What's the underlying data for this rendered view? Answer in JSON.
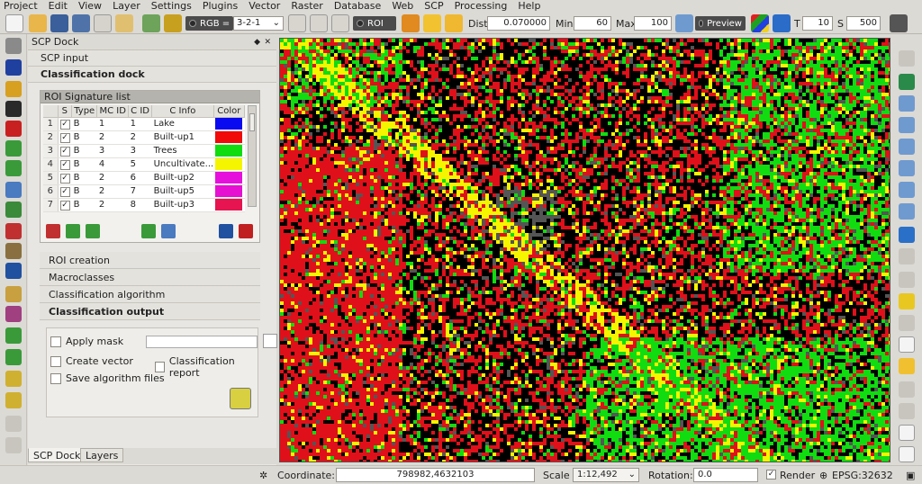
{
  "menu": [
    "Project",
    "Edit",
    "View",
    "Layer",
    "Settings",
    "Plugins",
    "Vector",
    "Raster",
    "Database",
    "Web",
    "SCP",
    "Processing",
    "Help"
  ],
  "toolbar": {
    "rgb_label": "RGB =",
    "rgb_value": "3-2-1",
    "roi_label": "ROI",
    "dist_label": "Dist",
    "dist_value": "0.070000",
    "min_label": "Min",
    "min_value": "60",
    "max_label": "Max",
    "max_value": "100",
    "preview_label": "Preview",
    "t_label": "T",
    "t_value": "10",
    "s_label": "S",
    "s_value": "500"
  },
  "dock": {
    "title": "SCP Dock",
    "tabs": [
      "SCP input",
      "Classification dock"
    ],
    "signature_list": {
      "title": "ROI Signature list",
      "columns": [
        "S",
        "Type",
        "MC ID",
        "C ID",
        "C Info",
        "Color"
      ],
      "rows": [
        {
          "n": "1",
          "type": "B",
          "mc": "1",
          "c": "1",
          "info": "Lake",
          "color": "#0a0af0"
        },
        {
          "n": "2",
          "type": "B",
          "mc": "2",
          "c": "2",
          "info": "Built-up1",
          "color": "#f00a0a"
        },
        {
          "n": "3",
          "type": "B",
          "mc": "3",
          "c": "3",
          "info": "Trees",
          "color": "#10dc10"
        },
        {
          "n": "4",
          "type": "B",
          "mc": "4",
          "c": "5",
          "info": "Uncultivate...",
          "color": "#f5f500"
        },
        {
          "n": "5",
          "type": "B",
          "mc": "2",
          "c": "6",
          "info": "Built-up2",
          "color": "#e610dc"
        },
        {
          "n": "6",
          "type": "B",
          "mc": "2",
          "c": "7",
          "info": "Built-up5",
          "color": "#e610d2"
        },
        {
          "n": "7",
          "type": "B",
          "mc": "2",
          "c": "8",
          "info": "Built-up3",
          "color": "#e61450"
        }
      ]
    },
    "sections": [
      "ROI creation",
      "Macroclasses",
      "Classification algorithm",
      "Classification output"
    ],
    "output": {
      "apply_mask": "Apply mask",
      "create_vector": "Create vector",
      "classification_report": "Classification report",
      "save_algorithm_files": "Save algorithm files"
    },
    "bottom_tabs": [
      "SCP Dock",
      "Layers"
    ]
  },
  "status": {
    "coordinate_label": "Coordinate:",
    "coordinate_value": "798982,4632103",
    "scale_label": "Scale",
    "scale_value": "1:12,492",
    "rotation_label": "Rotation:",
    "rotation_value": "0.0",
    "render_label": "Render",
    "crs": "EPSG:32632"
  },
  "colors": {
    "map_red": "#e0101a",
    "map_green": "#10dc10",
    "map_yellow": "#f5f500",
    "map_gray": "#555555"
  }
}
